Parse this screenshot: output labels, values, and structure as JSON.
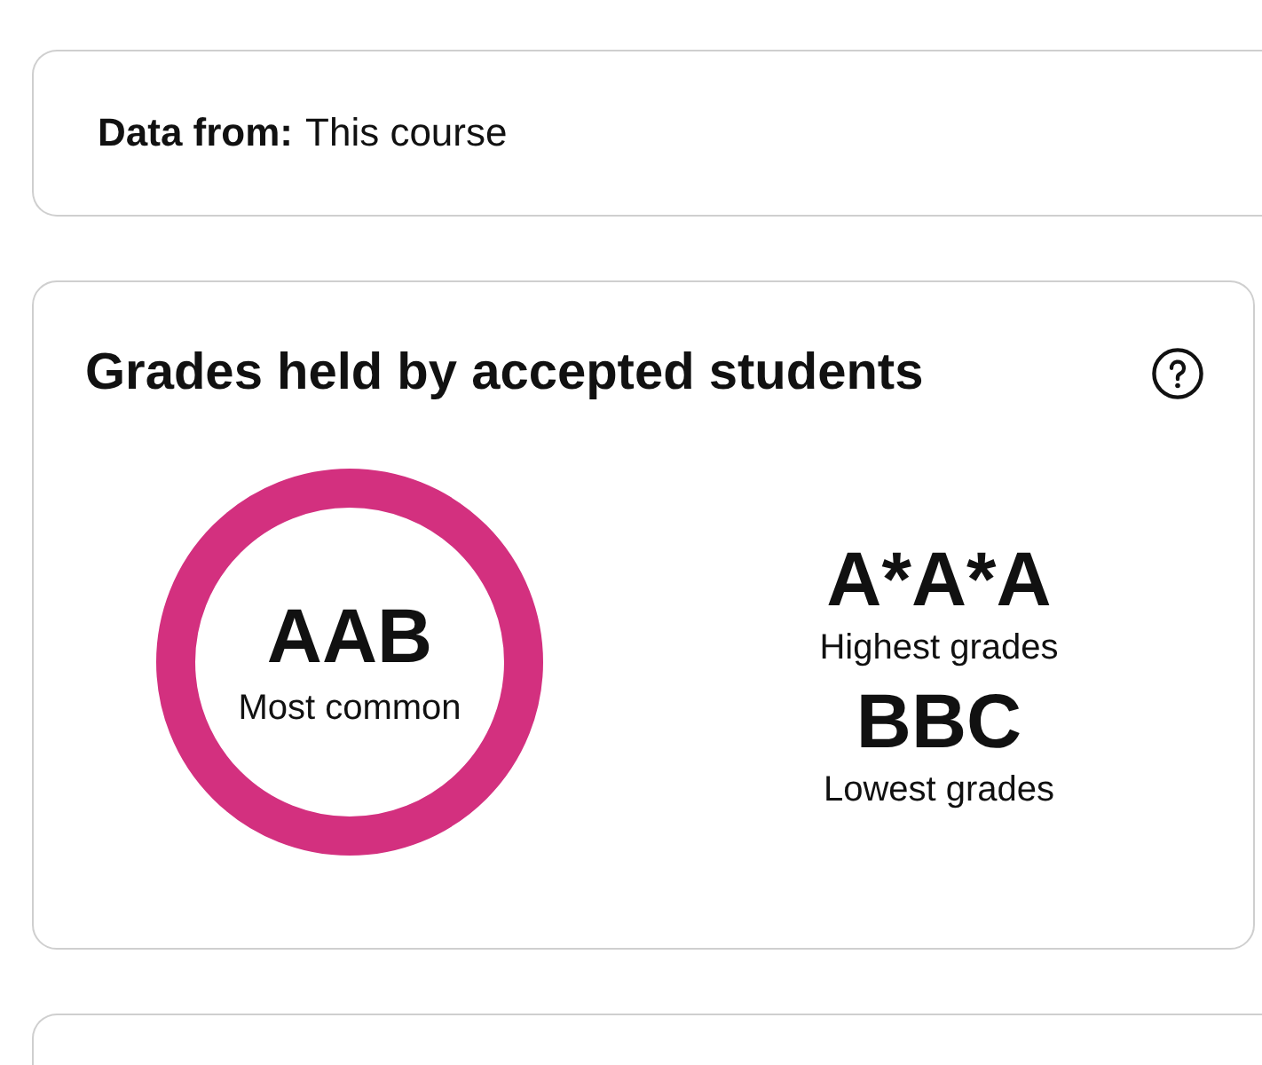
{
  "source": {
    "label": "Data from:",
    "value": "This course"
  },
  "grades_held": {
    "title": "Grades held by accepted students",
    "most_common": {
      "grade": "AAB",
      "label": "Most common"
    },
    "extremes": [
      {
        "grade": "A*A*A",
        "label": "Highest grades"
      },
      {
        "grade": "BBC",
        "label": "Lowest grades"
      }
    ]
  }
}
